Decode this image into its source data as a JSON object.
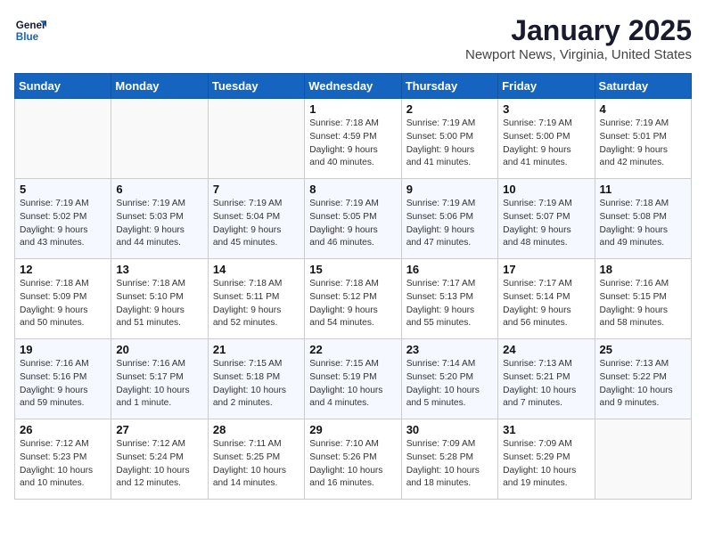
{
  "logo": {
    "line1": "General",
    "line2": "Blue"
  },
  "title": "January 2025",
  "subtitle": "Newport News, Virginia, United States",
  "weekdays": [
    "Sunday",
    "Monday",
    "Tuesday",
    "Wednesday",
    "Thursday",
    "Friday",
    "Saturday"
  ],
  "weeks": [
    [
      {
        "day": "",
        "detail": ""
      },
      {
        "day": "",
        "detail": ""
      },
      {
        "day": "",
        "detail": ""
      },
      {
        "day": "1",
        "detail": "Sunrise: 7:18 AM\nSunset: 4:59 PM\nDaylight: 9 hours\nand 40 minutes."
      },
      {
        "day": "2",
        "detail": "Sunrise: 7:19 AM\nSunset: 5:00 PM\nDaylight: 9 hours\nand 41 minutes."
      },
      {
        "day": "3",
        "detail": "Sunrise: 7:19 AM\nSunset: 5:00 PM\nDaylight: 9 hours\nand 41 minutes."
      },
      {
        "day": "4",
        "detail": "Sunrise: 7:19 AM\nSunset: 5:01 PM\nDaylight: 9 hours\nand 42 minutes."
      }
    ],
    [
      {
        "day": "5",
        "detail": "Sunrise: 7:19 AM\nSunset: 5:02 PM\nDaylight: 9 hours\nand 43 minutes."
      },
      {
        "day": "6",
        "detail": "Sunrise: 7:19 AM\nSunset: 5:03 PM\nDaylight: 9 hours\nand 44 minutes."
      },
      {
        "day": "7",
        "detail": "Sunrise: 7:19 AM\nSunset: 5:04 PM\nDaylight: 9 hours\nand 45 minutes."
      },
      {
        "day": "8",
        "detail": "Sunrise: 7:19 AM\nSunset: 5:05 PM\nDaylight: 9 hours\nand 46 minutes."
      },
      {
        "day": "9",
        "detail": "Sunrise: 7:19 AM\nSunset: 5:06 PM\nDaylight: 9 hours\nand 47 minutes."
      },
      {
        "day": "10",
        "detail": "Sunrise: 7:19 AM\nSunset: 5:07 PM\nDaylight: 9 hours\nand 48 minutes."
      },
      {
        "day": "11",
        "detail": "Sunrise: 7:18 AM\nSunset: 5:08 PM\nDaylight: 9 hours\nand 49 minutes."
      }
    ],
    [
      {
        "day": "12",
        "detail": "Sunrise: 7:18 AM\nSunset: 5:09 PM\nDaylight: 9 hours\nand 50 minutes."
      },
      {
        "day": "13",
        "detail": "Sunrise: 7:18 AM\nSunset: 5:10 PM\nDaylight: 9 hours\nand 51 minutes."
      },
      {
        "day": "14",
        "detail": "Sunrise: 7:18 AM\nSunset: 5:11 PM\nDaylight: 9 hours\nand 52 minutes."
      },
      {
        "day": "15",
        "detail": "Sunrise: 7:18 AM\nSunset: 5:12 PM\nDaylight: 9 hours\nand 54 minutes."
      },
      {
        "day": "16",
        "detail": "Sunrise: 7:17 AM\nSunset: 5:13 PM\nDaylight: 9 hours\nand 55 minutes."
      },
      {
        "day": "17",
        "detail": "Sunrise: 7:17 AM\nSunset: 5:14 PM\nDaylight: 9 hours\nand 56 minutes."
      },
      {
        "day": "18",
        "detail": "Sunrise: 7:16 AM\nSunset: 5:15 PM\nDaylight: 9 hours\nand 58 minutes."
      }
    ],
    [
      {
        "day": "19",
        "detail": "Sunrise: 7:16 AM\nSunset: 5:16 PM\nDaylight: 9 hours\nand 59 minutes."
      },
      {
        "day": "20",
        "detail": "Sunrise: 7:16 AM\nSunset: 5:17 PM\nDaylight: 10 hours\nand 1 minute."
      },
      {
        "day": "21",
        "detail": "Sunrise: 7:15 AM\nSunset: 5:18 PM\nDaylight: 10 hours\nand 2 minutes."
      },
      {
        "day": "22",
        "detail": "Sunrise: 7:15 AM\nSunset: 5:19 PM\nDaylight: 10 hours\nand 4 minutes."
      },
      {
        "day": "23",
        "detail": "Sunrise: 7:14 AM\nSunset: 5:20 PM\nDaylight: 10 hours\nand 5 minutes."
      },
      {
        "day": "24",
        "detail": "Sunrise: 7:13 AM\nSunset: 5:21 PM\nDaylight: 10 hours\nand 7 minutes."
      },
      {
        "day": "25",
        "detail": "Sunrise: 7:13 AM\nSunset: 5:22 PM\nDaylight: 10 hours\nand 9 minutes."
      }
    ],
    [
      {
        "day": "26",
        "detail": "Sunrise: 7:12 AM\nSunset: 5:23 PM\nDaylight: 10 hours\nand 10 minutes."
      },
      {
        "day": "27",
        "detail": "Sunrise: 7:12 AM\nSunset: 5:24 PM\nDaylight: 10 hours\nand 12 minutes."
      },
      {
        "day": "28",
        "detail": "Sunrise: 7:11 AM\nSunset: 5:25 PM\nDaylight: 10 hours\nand 14 minutes."
      },
      {
        "day": "29",
        "detail": "Sunrise: 7:10 AM\nSunset: 5:26 PM\nDaylight: 10 hours\nand 16 minutes."
      },
      {
        "day": "30",
        "detail": "Sunrise: 7:09 AM\nSunset: 5:28 PM\nDaylight: 10 hours\nand 18 minutes."
      },
      {
        "day": "31",
        "detail": "Sunrise: 7:09 AM\nSunset: 5:29 PM\nDaylight: 10 hours\nand 19 minutes."
      },
      {
        "day": "",
        "detail": ""
      }
    ]
  ]
}
